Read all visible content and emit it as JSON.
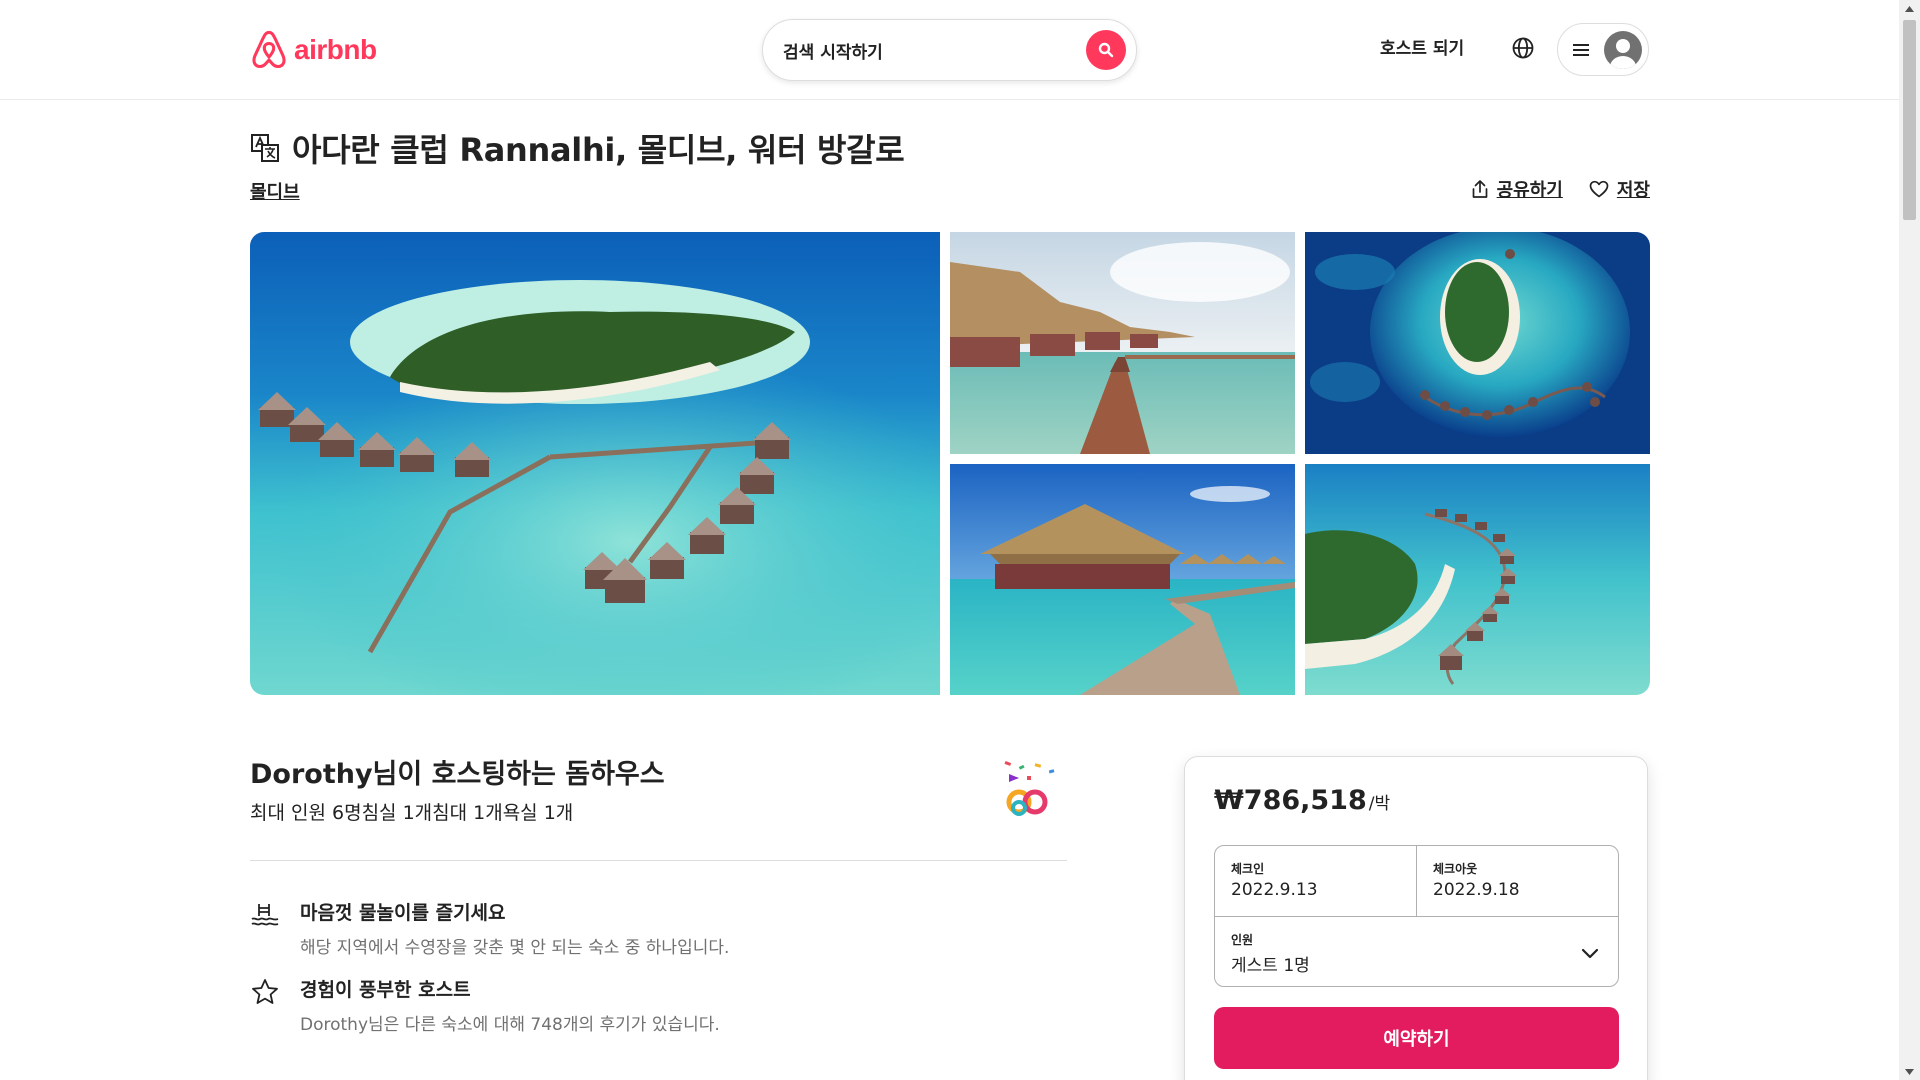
{
  "brand": {
    "name": "airbnb",
    "color": "#ff385c"
  },
  "header": {
    "search_placeholder": "검색 시작하기",
    "host_link": "호스트 되기",
    "globe_icon": "globe-icon",
    "menu_icon": "hamburger-icon",
    "avatar_icon": "user-avatar-icon"
  },
  "listing": {
    "title": "아다란 클럽 Rannalhi, 몰디브, 워터 방갈로",
    "location": "몰디브",
    "share": "공유하기",
    "save": "저장"
  },
  "photos": [
    {
      "alt": "island-aerial-with-water-villas"
    },
    {
      "alt": "thatched-water-villas-boardwalk"
    },
    {
      "alt": "atoll-aerial-view"
    },
    {
      "alt": "water-villa-pier"
    },
    {
      "alt": "curved-water-villa-row"
    }
  ],
  "host": {
    "heading": "Dorothy님이 호스팅하는 돔하우스",
    "details": "최대 인원 6명침실 1개침대 1개욕실 1개"
  },
  "features": [
    {
      "icon": "pool-icon",
      "title": "마음껏 물놀이를 즐기세요",
      "desc": "해당 지역에서 수영장을 갖춘 몇 안 되는 숙소 중 하나입니다."
    },
    {
      "icon": "star-icon",
      "title": "경험이 풍부한 호스트",
      "desc": "Dorothy님은 다른 숙소에 대해 748개의 후기가 있습니다."
    }
  ],
  "booking": {
    "price": "₩786,518",
    "per_night": "/박",
    "checkin_label": "체크인",
    "checkin_value": "2022.9.13",
    "checkout_label": "체크아웃",
    "checkout_value": "2022.9.18",
    "guests_label": "인원",
    "guests_value": "게스트 1명",
    "reserve": "예약하기",
    "accent": "#e31c5f"
  }
}
